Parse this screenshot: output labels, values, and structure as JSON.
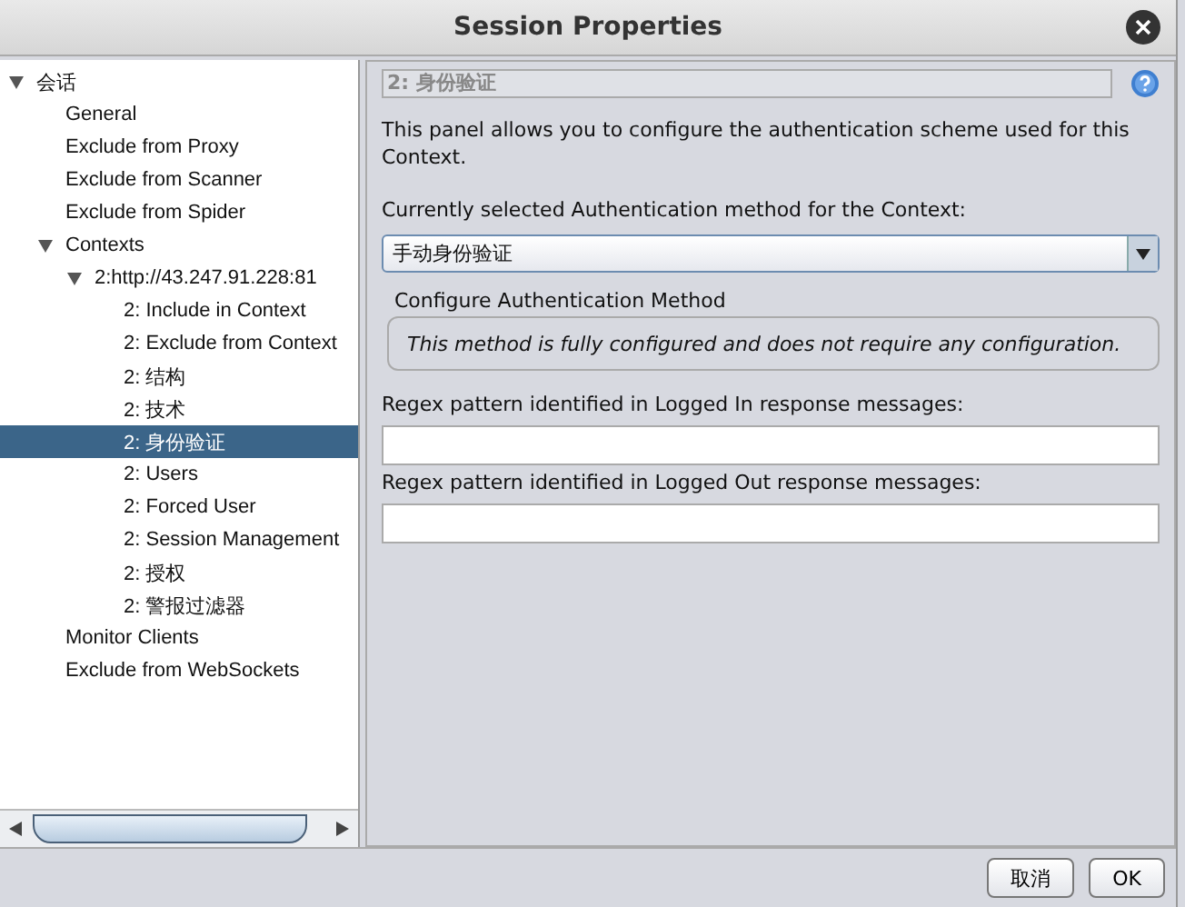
{
  "window": {
    "title": "Session Properties"
  },
  "tree": [
    {
      "label": "会话",
      "expanded": true,
      "selected": false,
      "children": [
        {
          "label": "General",
          "selected": false
        },
        {
          "label": "Exclude from Proxy",
          "selected": false
        },
        {
          "label": "Exclude from Scanner",
          "selected": false
        },
        {
          "label": "Exclude from Spider",
          "selected": false
        },
        {
          "label": "Contexts",
          "expanded": true,
          "selected": false,
          "children": [
            {
              "label": "2:http://43.247.91.228:81",
              "expanded": true,
              "selected": false,
              "children": [
                {
                  "label": "2: Include in Context",
                  "selected": false
                },
                {
                  "label": "2: Exclude from Context",
                  "selected": false
                },
                {
                  "label": "2: 结构",
                  "selected": false
                },
                {
                  "label": "2: 技术",
                  "selected": false
                },
                {
                  "label": "2: 身份验证",
                  "selected": true
                },
                {
                  "label": "2: Users",
                  "selected": false
                },
                {
                  "label": "2: Forced User",
                  "selected": false
                },
                {
                  "label": "2: Session Management",
                  "selected": false
                },
                {
                  "label": "2: 授权",
                  "selected": false
                },
                {
                  "label": "2: 警报过滤器",
                  "selected": false
                }
              ]
            }
          ]
        },
        {
          "label": "Monitor Clients",
          "selected": false
        },
        {
          "label": "Exclude from WebSockets",
          "selected": false
        }
      ]
    }
  ],
  "panel": {
    "heading": "2: 身份验证",
    "description": "This panel allows you to configure the authentication scheme used for this Context.",
    "method_label": "Currently selected Authentication method for the Context:",
    "method_value": "手动身份验证",
    "configure_title": "Configure Authentication Method",
    "configure_note": "This method is fully configured and does not require any configuration.",
    "logged_in_label": "Regex pattern identified in Logged In response messages:",
    "logged_out_label": "Regex pattern identified in Logged Out response messages:"
  },
  "buttons": [
    "取消",
    "OK"
  ]
}
